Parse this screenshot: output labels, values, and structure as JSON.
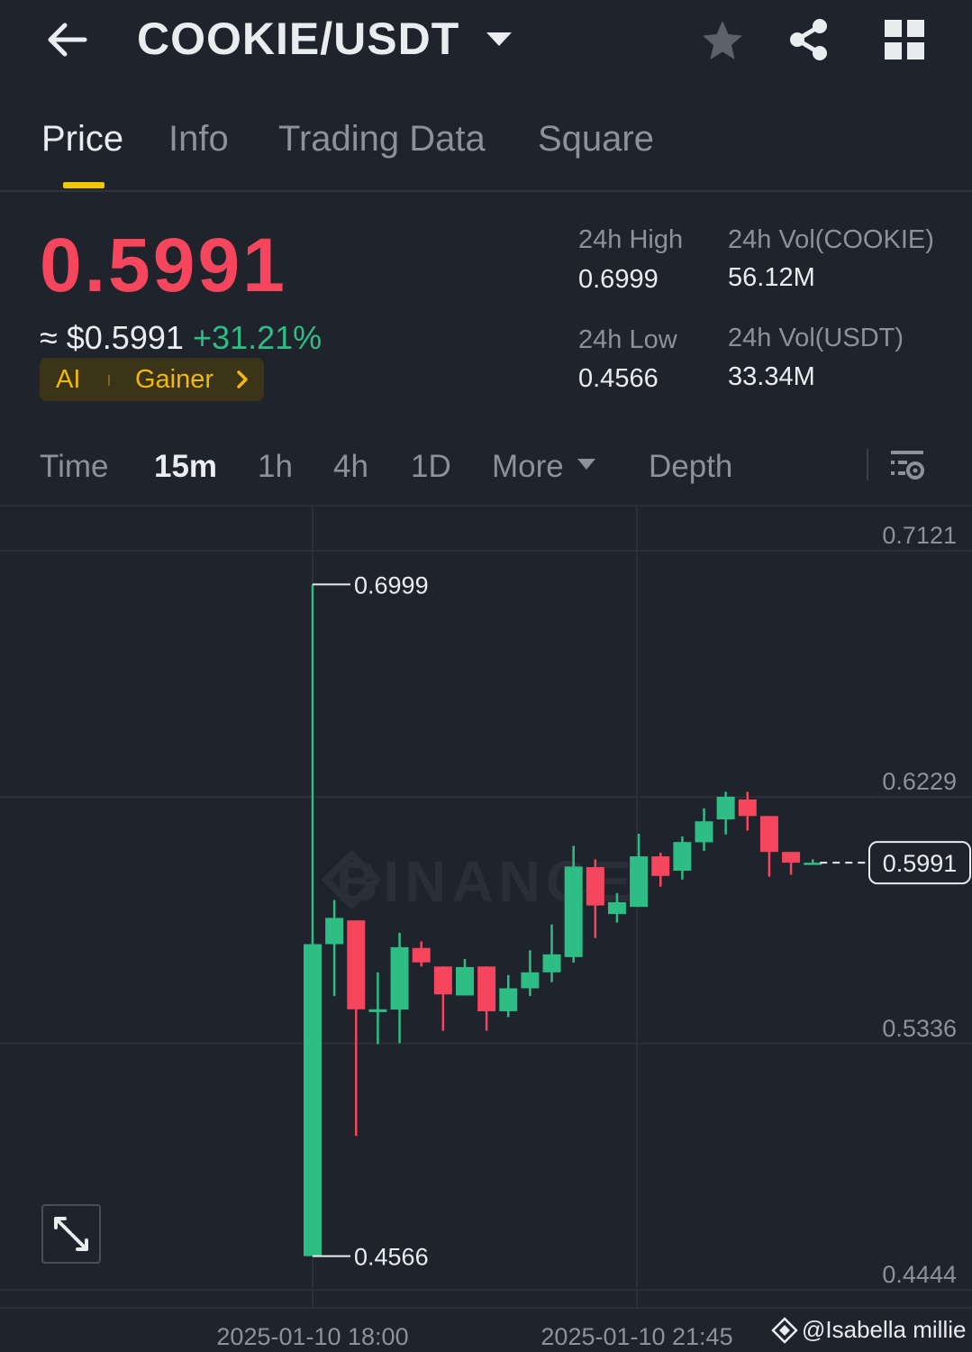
{
  "header": {
    "pair": "COOKIE/USDT",
    "icons": [
      "back-arrow-icon",
      "caret-down-icon",
      "star-icon",
      "share-icon",
      "grid-icon"
    ]
  },
  "tabs": [
    {
      "label": "Price",
      "active": true
    },
    {
      "label": "Info",
      "active": false
    },
    {
      "label": "Trading Data",
      "active": false
    },
    {
      "label": "Square",
      "active": false
    }
  ],
  "ticker": {
    "last_price": "0.5991",
    "fiat_price": "≈ $0.5991",
    "change": "+31.21%",
    "tag_ai": "AI",
    "tag_gainer": "Gainer",
    "high_label": "24h High",
    "high_value": "0.6999",
    "low_label": "24h Low",
    "low_value": "0.4566",
    "vol_base_label": "24h Vol(COOKIE)",
    "vol_base_value": "56.12M",
    "vol_quote_label": "24h Vol(USDT)",
    "vol_quote_value": "33.34M"
  },
  "intervals": {
    "items": [
      {
        "label": "Time",
        "active": false
      },
      {
        "label": "15m",
        "active": true
      },
      {
        "label": "1h",
        "active": false
      },
      {
        "label": "4h",
        "active": false
      },
      {
        "label": "1D",
        "active": false
      }
    ],
    "more_label": "More",
    "depth_label": "Depth"
  },
  "chart_data": {
    "type": "candlestick",
    "y_ticks": [
      0.7121,
      0.6229,
      0.5336,
      0.4444
    ],
    "ylim": [
      0.4444,
      0.7121
    ],
    "x_ticks": [
      "2025-01-10 18:00",
      "2025-01-10 21:45"
    ],
    "interval": "15m",
    "high_label": "0.6999",
    "low_label": "0.4566",
    "current_price": "0.5991",
    "watermark_brand": "BINANCE",
    "colors": {
      "up": "#2ebd85",
      "down": "#f6465d",
      "grid": "#2b3038",
      "text": "#8b929c"
    },
    "candles": [
      {
        "o": 0.4566,
        "h": 0.6999,
        "l": 0.4566,
        "c": 0.5696
      },
      {
        "o": 0.5696,
        "h": 0.5856,
        "l": 0.5508,
        "c": 0.5791
      },
      {
        "o": 0.5782,
        "h": 0.5782,
        "l": 0.5001,
        "c": 0.546
      },
      {
        "o": 0.545,
        "h": 0.5594,
        "l": 0.5334,
        "c": 0.546
      },
      {
        "o": 0.5459,
        "h": 0.5737,
        "l": 0.5337,
        "c": 0.5685
      },
      {
        "o": 0.5682,
        "h": 0.5706,
        "l": 0.5615,
        "c": 0.563
      },
      {
        "o": 0.5615,
        "h": 0.5615,
        "l": 0.5382,
        "c": 0.5514
      },
      {
        "o": 0.551,
        "h": 0.5642,
        "l": 0.5514,
        "c": 0.5613
      },
      {
        "o": 0.5615,
        "h": 0.5615,
        "l": 0.5382,
        "c": 0.5453
      },
      {
        "o": 0.5453,
        "h": 0.5584,
        "l": 0.5432,
        "c": 0.5536
      },
      {
        "o": 0.5536,
        "h": 0.5674,
        "l": 0.5508,
        "c": 0.5594
      },
      {
        "o": 0.5594,
        "h": 0.5767,
        "l": 0.5558,
        "c": 0.5659
      },
      {
        "o": 0.5649,
        "h": 0.6052,
        "l": 0.5629,
        "c": 0.5977
      },
      {
        "o": 0.5975,
        "h": 0.6003,
        "l": 0.5718,
        "c": 0.5836
      },
      {
        "o": 0.5805,
        "h": 0.5881,
        "l": 0.5774,
        "c": 0.5848
      },
      {
        "o": 0.5831,
        "h": 0.6096,
        "l": 0.5831,
        "c": 0.6014
      },
      {
        "o": 0.6014,
        "h": 0.6027,
        "l": 0.5904,
        "c": 0.5943
      },
      {
        "o": 0.5962,
        "h": 0.6086,
        "l": 0.593,
        "c": 0.6066
      },
      {
        "o": 0.6065,
        "h": 0.6188,
        "l": 0.6034,
        "c": 0.6141
      },
      {
        "o": 0.6148,
        "h": 0.6248,
        "l": 0.6093,
        "c": 0.623
      },
      {
        "o": 0.622,
        "h": 0.6248,
        "l": 0.6107,
        "c": 0.616
      },
      {
        "o": 0.616,
        "h": 0.616,
        "l": 0.594,
        "c": 0.603
      },
      {
        "o": 0.603,
        "h": 0.603,
        "l": 0.5947,
        "c": 0.5991
      },
      {
        "o": 0.5991,
        "h": 0.6003,
        "l": 0.5985,
        "c": 0.5991
      }
    ]
  },
  "watermark": {
    "handle": "@Isabella millie",
    "icon": "square-square-icon"
  }
}
